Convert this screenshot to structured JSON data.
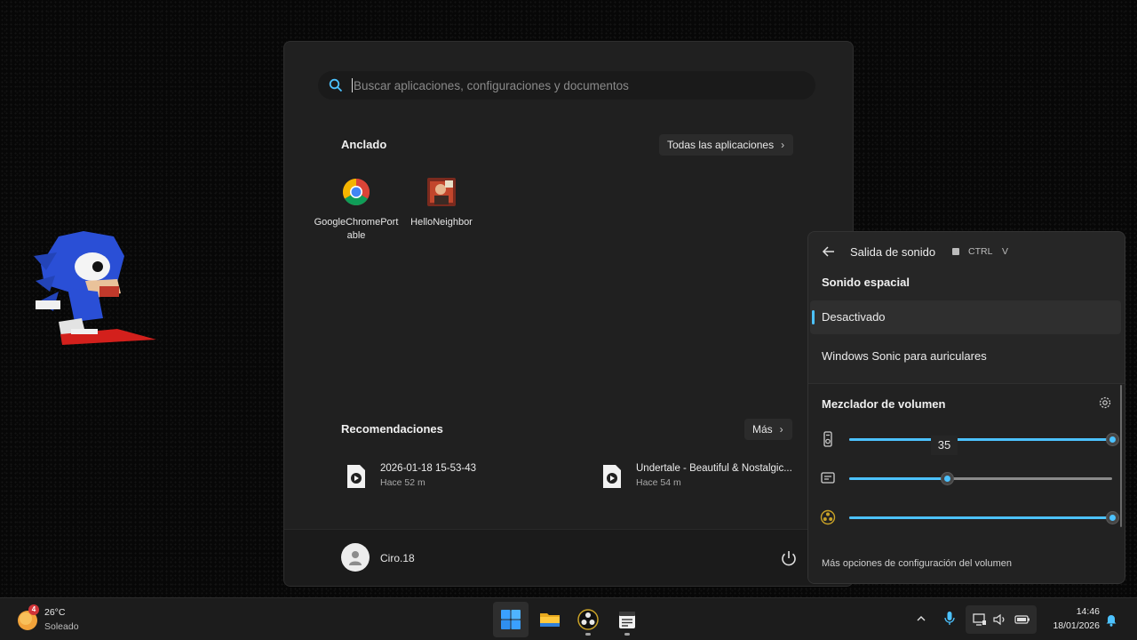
{
  "start_menu": {
    "search_placeholder": "Buscar aplicaciones, configuraciones y documentos",
    "pinned_title": "Anclado",
    "all_apps_label": "Todas las aplicaciones",
    "pinned_apps": [
      {
        "label": "GoogleChromePortable",
        "icon": "chrome-icon"
      },
      {
        "label": "HelloNeighbor",
        "icon": "hello-neighbor-icon"
      }
    ],
    "recommendations_title": "Recomendaciones",
    "more_label": "Más",
    "recommendations": [
      {
        "name": "2026-01-18 15-53-43",
        "time": "Hace 52 m",
        "icon": "video-file-icon"
      },
      {
        "name": "Undertale - Beautiful & Nostalgic...",
        "time": "Hace 54 m",
        "icon": "video-file-icon"
      }
    ],
    "user_name": "Ciro.18"
  },
  "sound_panel": {
    "title": "Salida de sonido",
    "shortcut_ctrl": "CTRL",
    "shortcut_key": "V",
    "spatial_title": "Sonido espacial",
    "options": [
      "Desactivado",
      "Windows Sonic para auriculares"
    ],
    "selected_option": "Desactivado",
    "mixer_title": "Mezclador de volumen",
    "sliders": [
      {
        "app": "speaker-device-icon",
        "value": 100,
        "tooltip": "35",
        "accent": "#4cc2ff"
      },
      {
        "app": "system-sounds-icon",
        "value": 37
      },
      {
        "app": "obs-icon",
        "value": 100
      }
    ],
    "more_options": "Más opciones de configuración del volumen"
  },
  "taskbar": {
    "weather_temp": "26°C",
    "weather_desc": "Soleado",
    "weather_badge": "4",
    "apps": [
      "windows-start-icon",
      "file-explorer-icon",
      "obs-studio-icon",
      "notepad-icon"
    ],
    "time": "14:46",
    "date": "18/01/2026"
  }
}
